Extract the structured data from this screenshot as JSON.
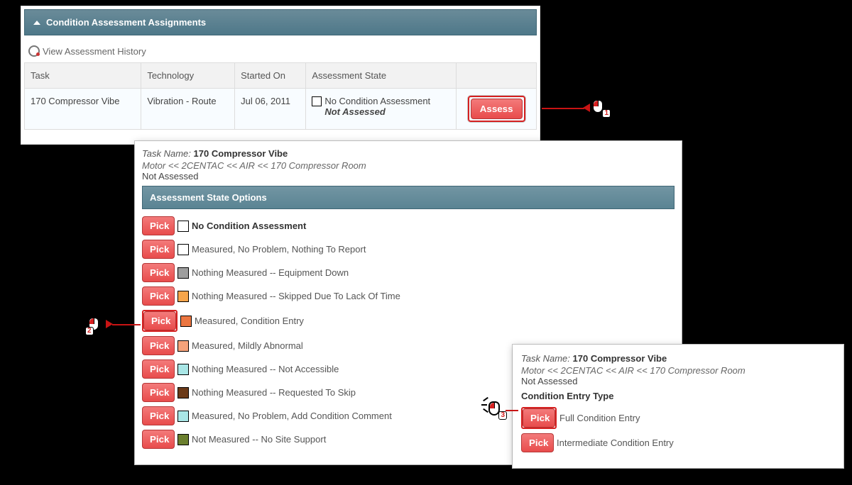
{
  "panel1": {
    "title": "Condition Assessment Assignments",
    "history_link": "View Assessment History",
    "columns": [
      "Task",
      "Technology",
      "Started On",
      "Assessment State"
    ],
    "row": {
      "task": "170 Compressor Vibe",
      "technology": "Vibration - Route",
      "started": "Jul 06, 2011",
      "state_text": "No Condition Assessment",
      "sub_state": "Not Assessed"
    },
    "assess_btn": "Assess"
  },
  "panel2": {
    "task_label": "Task Name:",
    "task_value": "170 Compressor Vibe",
    "breadcrumb": "Motor << 2CENTAC << AIR << 170 Compressor Room",
    "status": "Not Assessed",
    "options_title": "Assessment State Options",
    "pick_label": "Pick",
    "options": [
      {
        "swatch": "sw-white",
        "label": "No Condition Assessment",
        "bold": true
      },
      {
        "swatch": "sw-white",
        "label": "Measured, No Problem, Nothing To Report"
      },
      {
        "swatch": "sw-gray",
        "label": "Nothing Measured -- Equipment Down"
      },
      {
        "swatch": "sw-orange",
        "label": "Nothing Measured -- Skipped Due To Lack Of Time"
      },
      {
        "swatch": "sw-light",
        "label": "Measured, Condition Entry",
        "highlight": true
      },
      {
        "swatch": "sw-peach",
        "label": "Measured, Mildly Abnormal"
      },
      {
        "swatch": "sw-cyan",
        "label": "Nothing Measured -- Not Accessible"
      },
      {
        "swatch": "sw-brown",
        "label": "Nothing Measured -- Requested To Skip"
      },
      {
        "swatch": "sw-cyan",
        "label": "Measured, No Problem, Add Condition Comment"
      },
      {
        "swatch": "sw-olive",
        "label": "Not Measured -- No Site Support"
      }
    ]
  },
  "panel3": {
    "task_label": "Task Name:",
    "task_value": "170 Compressor Vibe",
    "breadcrumb": "Motor << 2CENTAC << AIR << 170 Compressor Room",
    "status": "Not Assessed",
    "section_title": "Condition Entry Type",
    "pick_label": "Pick",
    "options": [
      {
        "label": "Full Condition Entry",
        "highlight": true
      },
      {
        "label": "Intermediate Condition Entry"
      }
    ]
  },
  "callouts": {
    "n1": "1",
    "n2": "2",
    "n3": "3"
  }
}
